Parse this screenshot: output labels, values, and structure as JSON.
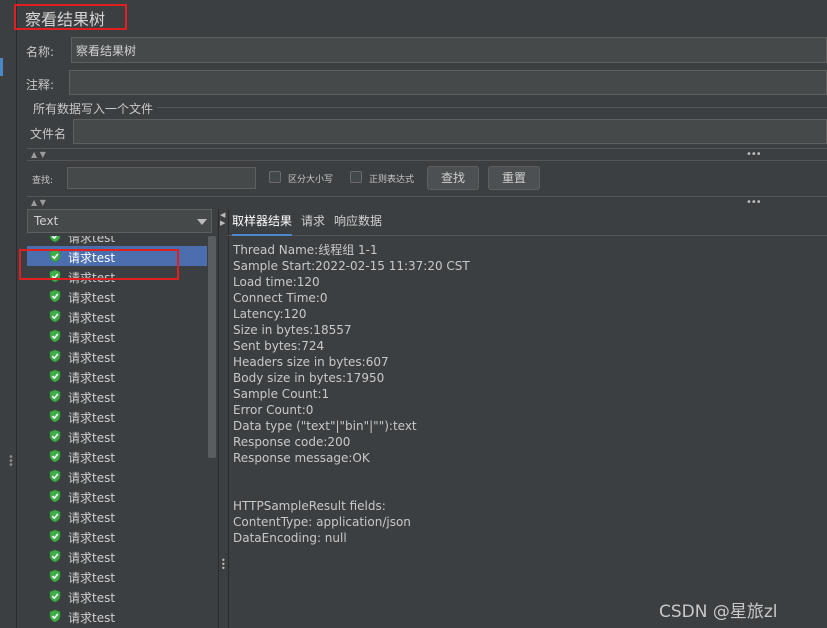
{
  "panel": {
    "title": "察看结果树"
  },
  "form": {
    "name_label": "名称:",
    "name_value": "察看结果树",
    "comment_label": "注释:",
    "comment_value": "",
    "file_group_title": "所有数据写入一个文件",
    "filename_label": "文件名",
    "filename_value": ""
  },
  "search": {
    "label": "查找:",
    "value": "",
    "case_label": "区分大小写",
    "regex_label": "正则表达式",
    "find_button": "查找",
    "reset_button": "重置"
  },
  "renderer": {
    "selected": "Text"
  },
  "tree": {
    "selected_index": 1,
    "items": [
      "请求test",
      "请求test",
      "请求test",
      "请求test",
      "请求test",
      "请求test",
      "请求test",
      "请求test",
      "请求test",
      "请求test",
      "请求test",
      "请求test",
      "请求test",
      "请求test",
      "请求test",
      "请求test",
      "请求test",
      "请求test",
      "请求test",
      "请求test"
    ]
  },
  "tabs": [
    "取样器结果",
    "请求",
    "响应数据"
  ],
  "result_lines": [
    "Thread Name:线程组 1-1",
    "Sample Start:2022-02-15 11:37:20 CST",
    "Load time:120",
    "Connect Time:0",
    "Latency:120",
    "Size in bytes:18557",
    "Sent bytes:724",
    "Headers size in bytes:607",
    "Body size in bytes:17950",
    "Sample Count:1",
    "Error Count:0",
    "Data type (\"text\"|\"bin\"|\"\"):text",
    "Response code:200",
    "Response message:OK",
    "",
    "",
    "HTTPSampleResult fields:",
    "ContentType: application/json",
    "DataEncoding: null"
  ],
  "watermark": "CSDN @星旅zl",
  "colors": {
    "accent": "#4a88c7",
    "selection": "#4b6eaf",
    "check_green": "#3fae49",
    "highlight_red": "#e02020"
  }
}
